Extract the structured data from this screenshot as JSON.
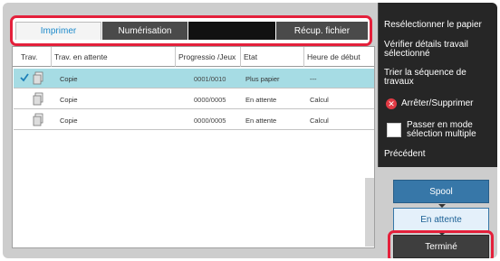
{
  "tabs": [
    {
      "label": "Imprimer",
      "active": true
    },
    {
      "label": "Numérisation",
      "active": false
    },
    {
      "label": "",
      "active": false
    },
    {
      "label": "Récup. fichier",
      "active": false
    }
  ],
  "table": {
    "headers": {
      "trav": "Trav.",
      "trav_en_attente": "Trav. en attente",
      "progression": "Progressio /Jeux",
      "etat": "Etat",
      "heure": "Heure de début"
    },
    "rows": [
      {
        "selected": true,
        "type": "Copie",
        "progress": "0001/0010",
        "state": "Plus papier",
        "time": "---"
      },
      {
        "selected": false,
        "type": "Copie",
        "progress": "0000/0005",
        "state": "En attente",
        "time": "Calcul"
      },
      {
        "selected": false,
        "type": "Copie",
        "progress": "0000/0005",
        "state": "En attente",
        "time": "Calcul"
      }
    ]
  },
  "menu": {
    "reselect": "Resélectionner le papier",
    "verify": "Vérifier détails travail sélectionné",
    "sort": "Trier la séquence de travaux",
    "stop": "Arrêter/Supprimer",
    "multi": "Passer en mode sélection multiple",
    "previous": "Précédent"
  },
  "buttons": {
    "spool": "Spool",
    "waiting": "En attente",
    "done": "Terminé"
  },
  "colors": {
    "highlight_ring": "#e4203b",
    "selected_row": "#a6dce4",
    "button_blue": "#3777a8",
    "menu_bg": "#262626"
  }
}
